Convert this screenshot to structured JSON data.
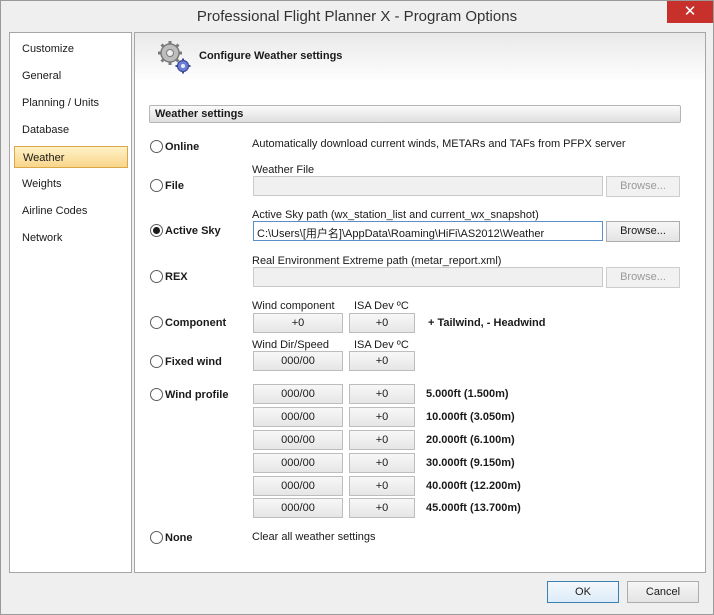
{
  "window": {
    "title": "Professional Flight Planner X - Program Options",
    "close_glyph": "✕"
  },
  "sidebar": {
    "items": [
      {
        "label": "Customize"
      },
      {
        "label": "General"
      },
      {
        "label": "Planning / Units"
      },
      {
        "label": "Database"
      },
      {
        "label": "Weather",
        "selected": true
      },
      {
        "label": "Weights"
      },
      {
        "label": "Airline Codes"
      },
      {
        "label": "Network"
      }
    ]
  },
  "header": {
    "title": "Configure Weather settings",
    "icon": "gears-icon"
  },
  "section": {
    "title": "Weather settings"
  },
  "options": {
    "online": {
      "label": "Online",
      "selected": false,
      "desc": "Automatically download current winds, METARs and TAFs from PFPX server"
    },
    "file": {
      "label": "File",
      "selected": false,
      "field_label": "Weather File",
      "value": "",
      "browse": "Browse..."
    },
    "active_sky": {
      "label": "Active Sky",
      "selected": true,
      "field_label": "Active Sky path (wx_station_list and current_wx_snapshot)",
      "value": "C:\\Users\\[用户名]\\AppData\\Roaming\\HiFi\\AS2012\\Weather",
      "browse": "Browse..."
    },
    "rex": {
      "label": "REX",
      "selected": false,
      "field_label": "Real Environment Extreme path (metar_report.xml)",
      "value": "",
      "browse": "Browse..."
    },
    "component": {
      "label": "Component",
      "selected": false,
      "col1": "Wind component",
      "col2": "ISA Dev ºC",
      "wind": "+0",
      "isa": "+0",
      "note": "+ Tailwind,  - Headwind"
    },
    "fixed_wind": {
      "label": "Fixed wind",
      "selected": false,
      "col1": "Wind Dir/Speed",
      "col2": "ISA Dev ºC",
      "wind": "000/00",
      "isa": "+0"
    },
    "wind_profile": {
      "label": "Wind profile",
      "selected": false,
      "rows": [
        {
          "wind": "000/00",
          "isa": "+0",
          "alt": "5.000ft (1.500m)"
        },
        {
          "wind": "000/00",
          "isa": "+0",
          "alt": "10.000ft (3.050m)"
        },
        {
          "wind": "000/00",
          "isa": "+0",
          "alt": "20.000ft (6.100m)"
        },
        {
          "wind": "000/00",
          "isa": "+0",
          "alt": "30.000ft (9.150m)"
        },
        {
          "wind": "000/00",
          "isa": "+0",
          "alt": "40.000ft (12.200m)"
        },
        {
          "wind": "000/00",
          "isa": "+0",
          "alt": "45.000ft (13.700m)"
        }
      ]
    },
    "none": {
      "label": "None",
      "selected": false,
      "desc": "Clear all weather settings"
    }
  },
  "footer": {
    "ok": "OK",
    "cancel": "Cancel"
  }
}
